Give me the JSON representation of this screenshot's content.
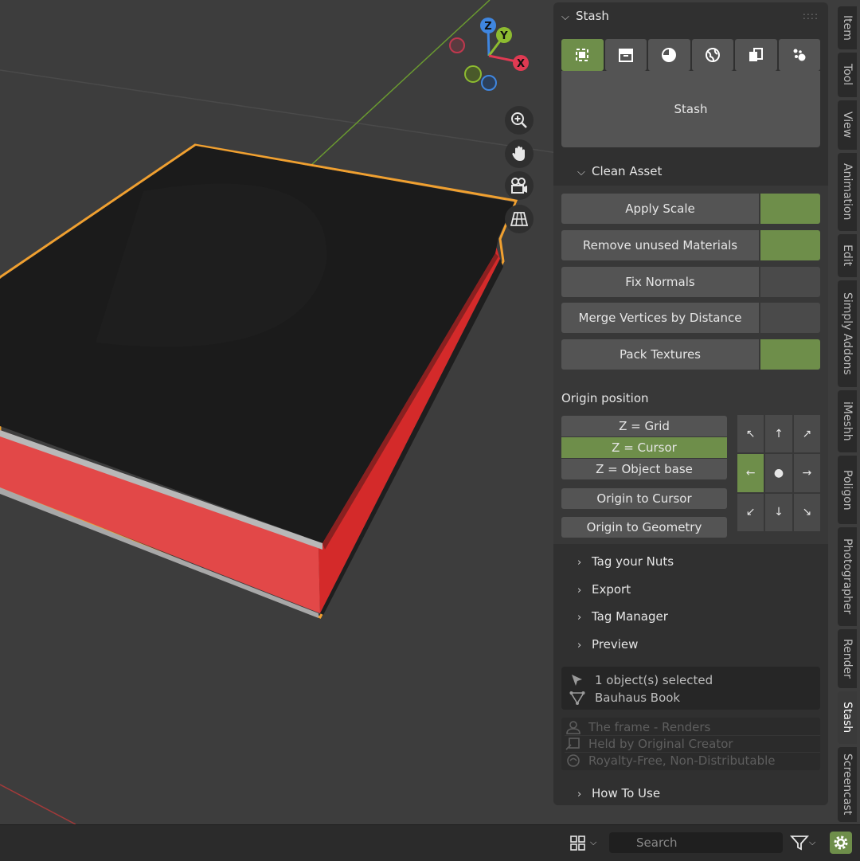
{
  "viewport": {
    "gizmo": {
      "z": "Z",
      "y": "Y",
      "x": "X"
    }
  },
  "panel": {
    "title": "Stash",
    "tabs": [
      "select-icon",
      "archive-icon",
      "material-icon",
      "world-icon",
      "copy-icon",
      "particles-icon"
    ],
    "stash_button": "Stash",
    "clean_asset": {
      "header": "Clean Asset",
      "ops": [
        {
          "label": "Apply Scale",
          "checked": true
        },
        {
          "label": "Remove unused Materials",
          "checked": true
        },
        {
          "label": "Fix Normals",
          "checked": false
        },
        {
          "label": "Merge Vertices by Distance",
          "checked": false
        },
        {
          "label": "Pack Textures",
          "checked": true
        }
      ]
    },
    "origin": {
      "title": "Origin position",
      "z_grid": "Z = Grid",
      "z_cursor": "Z = Cursor",
      "z_object_base": "Z = Object base",
      "to_cursor": "Origin to Cursor",
      "to_geometry": "Origin to Geometry",
      "grid": [
        "↖",
        "↑",
        "↗",
        "←",
        "●",
        "→",
        "↙",
        "↓",
        "↘"
      ]
    },
    "sections": {
      "tag_nuts": "Tag your Nuts",
      "export": "Export",
      "tag_manager": "Tag Manager",
      "preview": "Preview",
      "how_to_use": "How To Use"
    },
    "info": {
      "selected": "1 object(s) selected",
      "name": "Bauhaus Book"
    },
    "license": {
      "author": "The frame - Renders",
      "held": "Held by Original Creator",
      "terms": "Royalty-Free, Non-Distributable"
    }
  },
  "side_tabs": [
    "Item",
    "Tool",
    "View",
    "Animation",
    "Edit",
    "Simply Addons",
    "iMeshh",
    "Poligon",
    "Photographer",
    "Render",
    "Stash",
    "Screencast"
  ],
  "bottombar": {
    "search_placeholder": "Search"
  },
  "colors": {
    "accent": "#6e8e4a",
    "selection": "#f0a030",
    "book_cover": "#1a1a1a",
    "book_pages": "#e85050"
  }
}
